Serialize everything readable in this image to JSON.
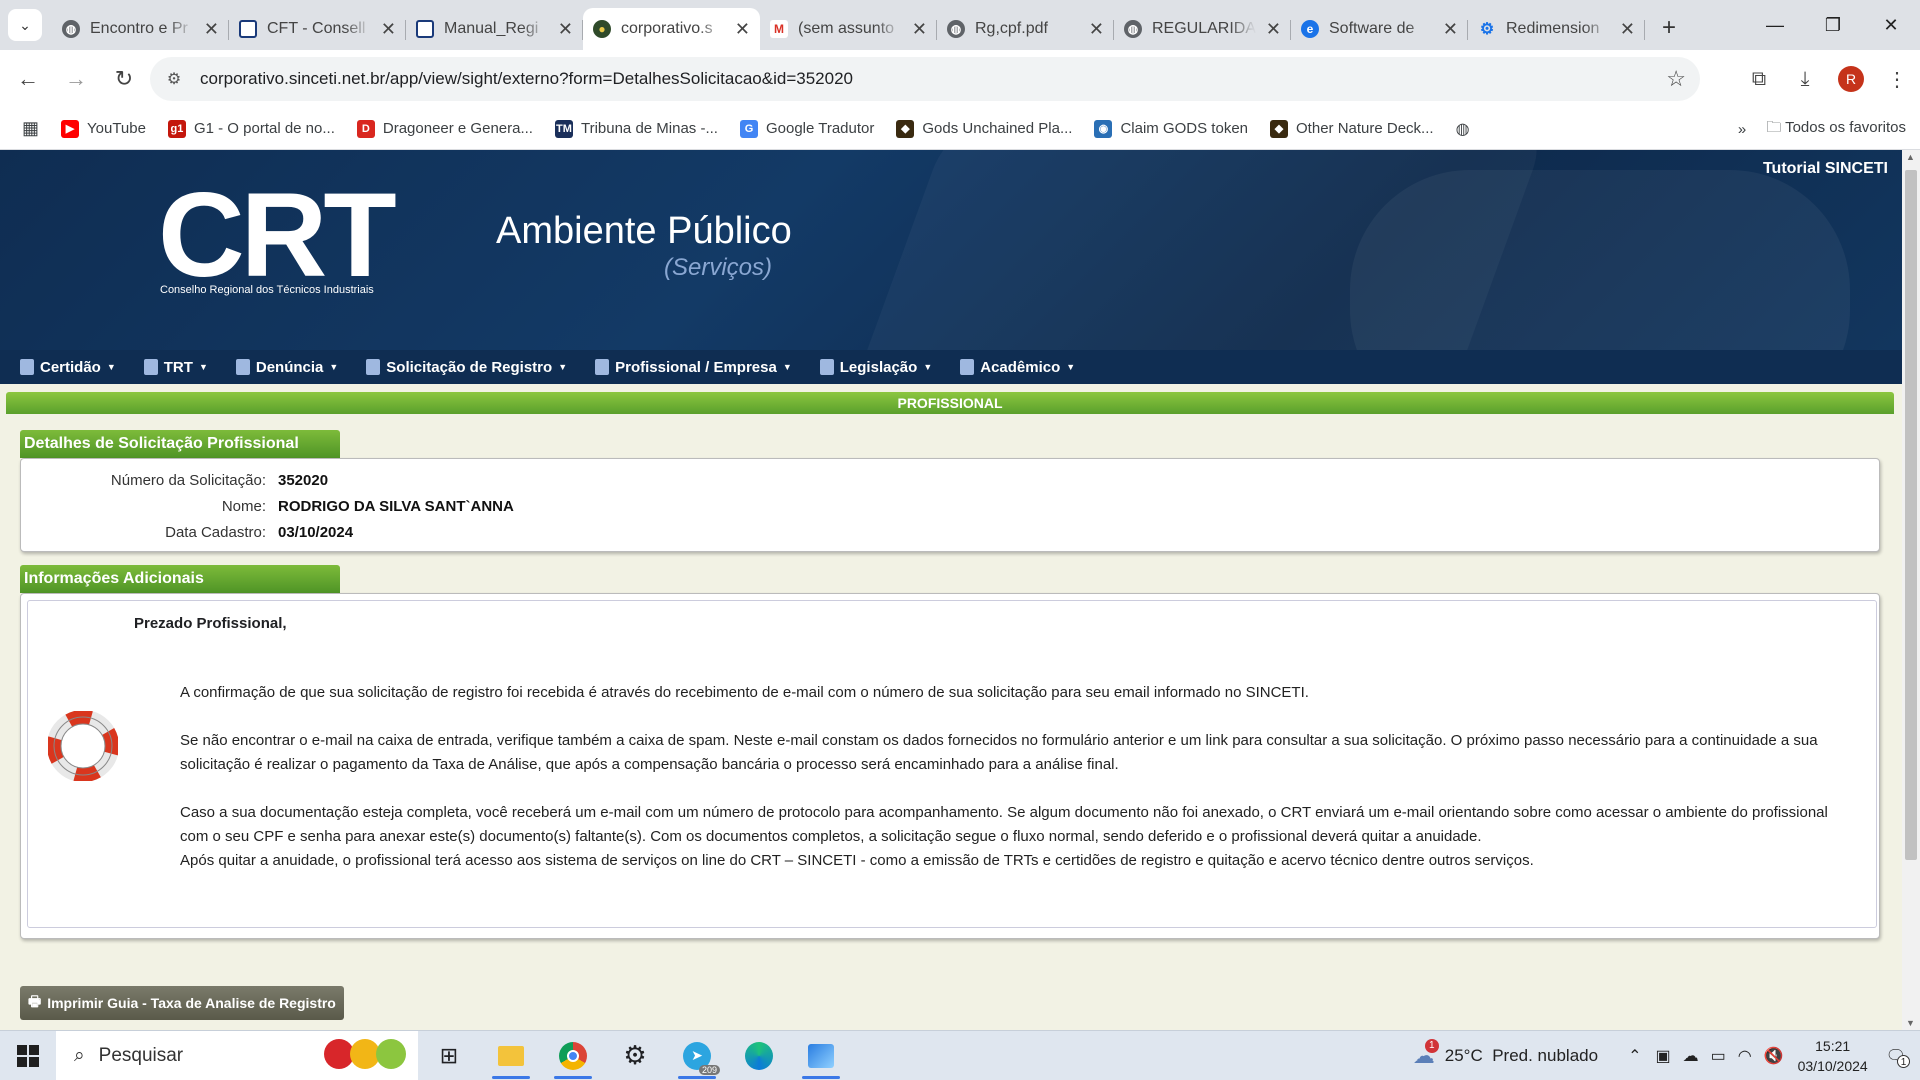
{
  "browser": {
    "tabs": [
      {
        "title": "Encontro e Pr",
        "icon": "globe-icon",
        "active": false
      },
      {
        "title": "CFT - Consell",
        "icon": "doc-icon",
        "active": false
      },
      {
        "title": "Manual_Regi",
        "icon": "doc-icon",
        "active": false
      },
      {
        "title": "corporativo.s",
        "icon": "crt-favicon",
        "active": true
      },
      {
        "title": "(sem assunto",
        "icon": "gmail-icon",
        "active": false
      },
      {
        "title": "Rg,cpf.pdf",
        "icon": "globe-icon",
        "active": false
      },
      {
        "title": "REGULARIDA",
        "icon": "globe-icon",
        "active": false
      },
      {
        "title": "Software de",
        "icon": "edge-icon",
        "active": false
      },
      {
        "title": "Redimension",
        "icon": "gear-icon",
        "active": false
      }
    ],
    "url": "corporativo.sinceti.net.br/app/view/sight/externo?form=DetalhesSolicitacao&id=352020",
    "profile_initial": "R",
    "bookmarks": [
      {
        "label": "YouTube",
        "color": "#ff0000",
        "glyph": "▶"
      },
      {
        "label": "G1 - O portal de no...",
        "color": "#c4170c",
        "glyph": "g1"
      },
      {
        "label": "Dragoneer e Genera...",
        "color": "#d9271f",
        "glyph": "D"
      },
      {
        "label": "Tribuna de Minas -...",
        "color": "#1a2f5a",
        "glyph": "TM"
      },
      {
        "label": "Google Tradutor",
        "color": "#4285f4",
        "glyph": "G"
      },
      {
        "label": "Gods Unchained Pla...",
        "color": "#3a2a10",
        "glyph": "◆"
      },
      {
        "label": "Claim GODS token",
        "color": "#2a6fb5",
        "glyph": "◉"
      },
      {
        "label": "Other Nature Deck...",
        "color": "#3a2a10",
        "glyph": "◆"
      }
    ],
    "favorites_label": "Todos os favoritos"
  },
  "site": {
    "logo": "CRT",
    "logo_sub": "Conselho Regional dos Técnicos Industriais",
    "title": "Ambiente Público",
    "subtitle": "(Serviços)",
    "tutorial": "Tutorial SINCETI",
    "menu": [
      "Certidão",
      "TRT",
      "Denúncia",
      "Solicitação de Registro",
      "Profissional / Empresa",
      "Legislação",
      "Acadêmico"
    ]
  },
  "content": {
    "section_bar": "PROFISSIONAL",
    "details_title": "Detalhes de Solicitação Profissional",
    "fields": [
      {
        "label": "Número da Solicitação:",
        "value": "352020"
      },
      {
        "label": "Nome:",
        "value": "RODRIGO DA SILVA SANT`ANNA"
      },
      {
        "label": "Data Cadastro:",
        "value": "03/10/2024"
      }
    ],
    "info_title": "Informações Adicionais",
    "greeting": "Prezado Profissional,",
    "paragraphs": [
      "A confirmação de que sua solicitação de registro foi recebida é através do recebimento de e-mail com o número de sua solicitação para seu email informado no SINCETI.",
      "Se não encontrar o e-mail na caixa de entrada, verifique também a caixa de spam. Neste e-mail constam os dados fornecidos no formulário anterior e um link para consultar a sua solicitação. O próximo passo necessário para a continuidade a sua solicitação é realizar o pagamento da Taxa de Análise, que após a compensação bancária o processo será encaminhado para a análise final.",
      "Caso a sua documentação esteja completa, você receberá um e-mail com um número de protocolo para acompanhamento. Se algum documento não foi anexado, o CRT enviará um e-mail orientando sobre como acessar o ambiente do profissional com o seu CPF e senha para anexar este(s) documento(s) faltante(s). Com os documentos completos, a solicitação segue o fluxo normal, sendo deferido e o profissional deverá quitar a anuidade.",
      "Após quitar a anuidade, o profissional terá acesso aos sistema de serviços on line do CRT – SINCETI - como a emissão de TRTs e certidões de registro e quitação e acervo técnico dentre outros serviços."
    ],
    "print_button": "Imprimir Guia - Taxa de Analise de Registro"
  },
  "taskbar": {
    "search_placeholder": "Pesquisar",
    "telegram_badge": "209",
    "weather": "25°C  Pred. nublado",
    "weather_alert": "1",
    "time": "15:21",
    "date": "03/10/2024",
    "notification_count": "1"
  }
}
